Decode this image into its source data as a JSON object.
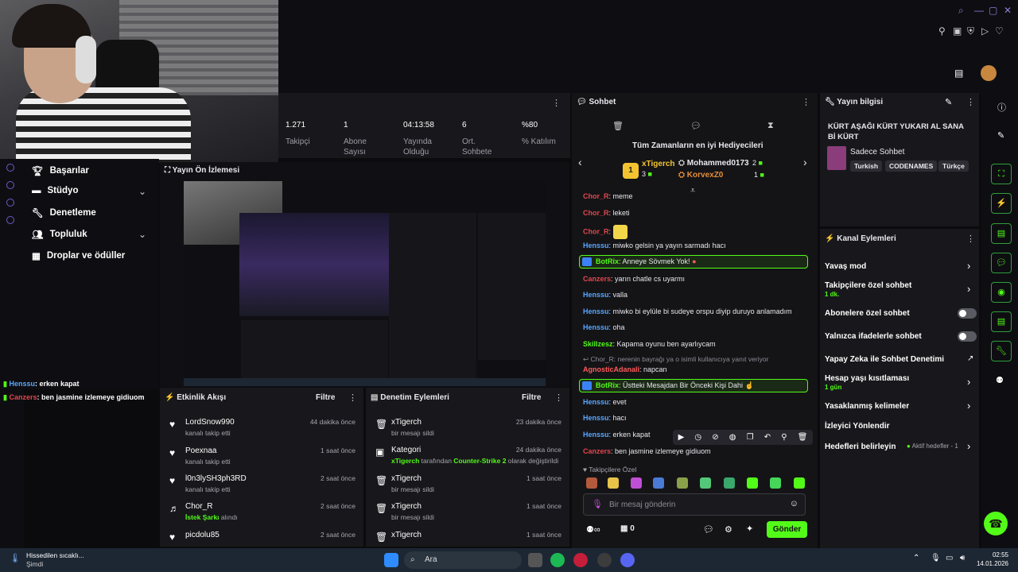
{
  "stats": [
    {
      "value": "1.271",
      "label": "Takipçi"
    },
    {
      "value": "1",
      "label": "Abone Sayısı"
    },
    {
      "value": "04:13:58",
      "label": "Yayında Olduğu"
    },
    {
      "value": "6",
      "label": "Ort. Sohbete"
    },
    {
      "value": "%80",
      "label": "% Katılım"
    }
  ],
  "nav": {
    "items": [
      "Başarılar",
      "Stüdyo",
      "Denetleme",
      "Topluluk",
      "Droplar ve ödüller"
    ]
  },
  "preview": {
    "title": "Yayın Ön İzlemesi"
  },
  "left_chat": [
    {
      "user": "Henssu",
      "text": ": erken kapat"
    },
    {
      "user": "Canzers",
      "text": ": ben jasmine izlemeye gidiuom"
    }
  ],
  "feed": {
    "title": "Etkinlik Akışı",
    "filter": "Filtre",
    "rows": [
      {
        "name": "LordSnow990",
        "sub": "kanalı takip etti",
        "time": "44 dakika önce"
      },
      {
        "name": "Poexnaa",
        "sub": "kanalı takip etti",
        "time": "1 saat önce"
      },
      {
        "name": "l0n3lySH3ph3RD",
        "sub": "kanalı takip etti",
        "time": "2 saat önce"
      },
      {
        "name": "Chor_R",
        "sub_hl": "İstek Şarkı",
        "sub": " alındı",
        "time": "2 saat önce"
      },
      {
        "name": "picdolu85",
        "sub": "",
        "time": "2 saat önce"
      }
    ]
  },
  "mod": {
    "title": "Denetim Eylemleri",
    "filter": "Filtre",
    "rows": [
      {
        "name": "xTigerch",
        "sub": "bir mesajı sildi",
        "time": "23 dakika önce"
      },
      {
        "name": "Kategori",
        "sub_a": "xTigerch",
        "sub_b": " tarafından ",
        "sub_c": "Counter-Strike 2",
        "sub_d": " olarak değiştirildi",
        "time": "24 dakika önce"
      },
      {
        "name": "xTigerch",
        "sub": "bir mesajı sildi",
        "time": "1 saat önce"
      },
      {
        "name": "xTigerch",
        "sub": "bir mesajı sildi",
        "time": "1 saat önce"
      },
      {
        "name": "xTigerch",
        "sub": "",
        "time": "1 saat önce"
      }
    ]
  },
  "chat": {
    "title": "Sohbet",
    "gifters_title": "Tüm Zamanların en iyi Hediyecileri",
    "gifters": [
      {
        "rank": "1",
        "name": "xTigerch",
        "count": "3"
      },
      {
        "name": "Mohammed0173",
        "count": "2"
      },
      {
        "name": "KorvexZ0",
        "count": "1"
      }
    ],
    "messages": [
      {
        "user": "Chor_R",
        "text": ": meme",
        "c": "u-red"
      },
      {
        "user": "Chor_R",
        "text": ": leketi",
        "c": "u-red"
      },
      {
        "user": "Chor_R",
        "text": ":",
        "c": "u-red"
      },
      {
        "user": "Henssu",
        "text": ": miwko gelsin ya yayın sarmadı hacı",
        "c": "u-blue"
      },
      {
        "user": "Canzers",
        "text": ": yarın chatle cs uyarmı",
        "c": "u-red"
      },
      {
        "user": "Henssu",
        "text": ": valla",
        "c": "u-blue"
      },
      {
        "user": "Henssu",
        "text": ": miwko bi eylüle bi sudeye orspu diyip duruyo anlamadım",
        "c": "u-blue"
      },
      {
        "user": "Henssu",
        "text": ": oha",
        "c": "u-blue"
      },
      {
        "user": "Skillzesz",
        "text": ": Kapama oyunu ben ayarlıycam",
        "c": "u-green"
      },
      {
        "user": "AgnosticAdanali",
        "text": ": napcan",
        "c": "u-pink"
      },
      {
        "user": "Henssu",
        "text": ": evet",
        "c": "u-blue"
      },
      {
        "user": "Henssu",
        "text": ": hacı",
        "c": "u-blue"
      },
      {
        "user": "Henssu",
        "text": ": erken kapat",
        "c": "u-blue"
      },
      {
        "user": "Canzers",
        "text": ": ben jasmine izlemeye gidiuom",
        "c": "u-red"
      }
    ],
    "reply_note": "Chor_R: nerenin bayrağı ya o isimli kullanıcıya yanıt veriyor",
    "bot1": {
      "user": "BotRix",
      "text": ": Anneye Sövmek Yok!"
    },
    "bot2": {
      "user": "BotRix",
      "text": ": Üstteki Mesajdan Bir Önceki Kişi Dahi"
    },
    "emote_section": "Takipçilere Özel",
    "input_placeholder": "Bir mesaj gönderin",
    "points": "0",
    "send": "Gönder"
  },
  "info": {
    "title": "Yayın bilgisi",
    "stream_title": "KÜRT AŞAĞI KÜRT YUKARI AL SANA Bİ KÜRT",
    "category": "Sadece Sohbet",
    "tags": [
      "Turkish",
      "CODENAMES",
      "Türkçe"
    ]
  },
  "actions": {
    "title": "Kanal Eylemleri",
    "items": [
      {
        "label": "Yavaş mod"
      },
      {
        "label": "Takipçilere özel sohbet",
        "sub": "1 dk."
      },
      {
        "label": "Abonelere özel sohbet"
      },
      {
        "label": "Yalnızca ifadelerle sohbet"
      },
      {
        "label": "Yapay Zeka ile Sohbet Denetimi"
      },
      {
        "label": "Hesap yaşı kısıtlaması",
        "sub": "1 gün"
      },
      {
        "label": "Yasaklanmış kelimeler"
      },
      {
        "label": "İzleyici Yönlendir"
      },
      {
        "label": "Hedefleri belirleyin",
        "extra": "Aktif hedefler - 1"
      }
    ]
  },
  "taskbar": {
    "weather": "Hissedilen sıcaklı...",
    "weather_sub": "Şimdi",
    "search": "Ara",
    "time": "02:55",
    "date": "14.01.2026"
  },
  "colors": {
    "accent": "#53fc18",
    "panel": "#18181c",
    "bg": "#0b0b0e"
  }
}
